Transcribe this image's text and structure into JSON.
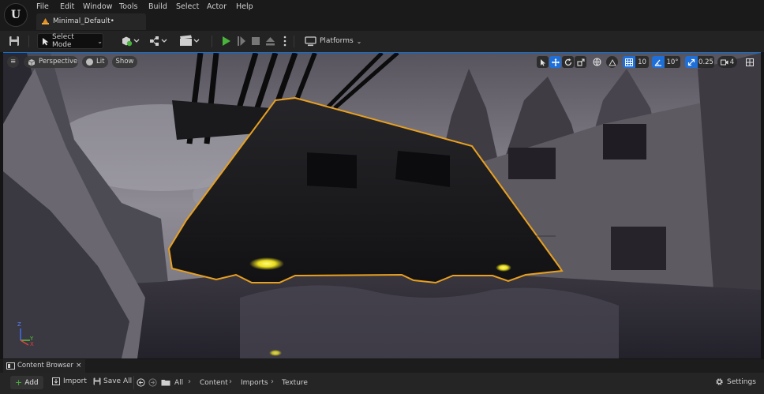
{
  "menu": {
    "items": [
      "File",
      "Edit",
      "Window",
      "Tools",
      "Build",
      "Select",
      "Actor",
      "Help"
    ]
  },
  "document_tab": {
    "label": "Minimal_Default•"
  },
  "toolbar": {
    "select_mode_label": "Select Mode",
    "platforms_label": "Platforms"
  },
  "viewport": {
    "perspective_label": "Perspective",
    "lit_label": "Lit",
    "show_label": "Show",
    "grid_snap_value": "10",
    "rotation_snap_value": "10°",
    "scale_snap_value": "0.25",
    "camera_speed_value": "4",
    "axis_x_label": "X",
    "axis_y_label": "Y",
    "axis_z_label": "Z"
  },
  "content_browser": {
    "tab_label": "Content Browser",
    "close_glyph": "×",
    "add_label": "Add",
    "import_label": "Import",
    "save_all_label": "Save All",
    "breadcrumbs": [
      "All",
      "Content",
      "Imports",
      "Texture"
    ],
    "settings_label": "Settings"
  },
  "colors": {
    "accent_blue": "#1f6fd8",
    "play_green": "#49b43c",
    "selection_orange": "#e8a020"
  }
}
